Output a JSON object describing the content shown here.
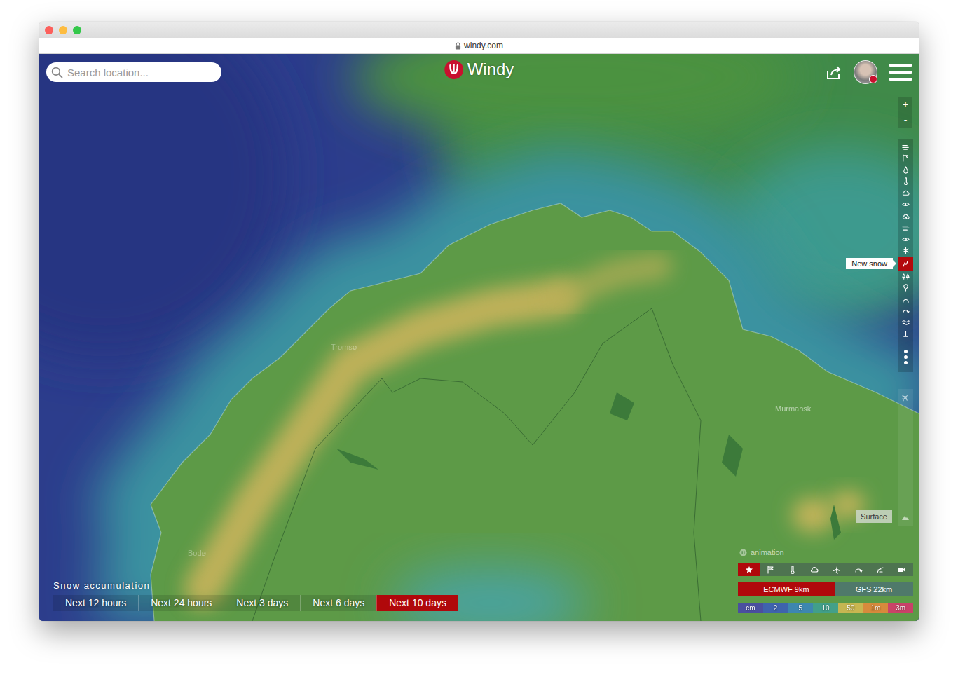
{
  "browser": {
    "url": "windy.com"
  },
  "header": {
    "logo": "Windy",
    "search_placeholder": "Search location..."
  },
  "zoom": {
    "in": "+",
    "out": "-"
  },
  "layers": [
    {
      "selected": false
    },
    {
      "selected": false
    },
    {
      "selected": false
    },
    {
      "selected": false
    },
    {
      "selected": false
    },
    {
      "selected": false
    },
    {
      "selected": false
    },
    {
      "selected": false
    },
    {
      "selected": false
    },
    {
      "selected": false
    },
    {
      "selected": true
    },
    {
      "selected": false
    },
    {
      "selected": false
    },
    {
      "selected": false
    },
    {
      "selected": false
    },
    {
      "selected": false
    },
    {
      "selected": false
    }
  ],
  "layer_tooltip": "New snow",
  "level": {
    "label": "Surface"
  },
  "map_labels": [
    {
      "name": "Tromsø"
    },
    {
      "name": "Murmansk"
    },
    {
      "name": "Bodø"
    }
  ],
  "accumulation": {
    "title": "Snow accumulation",
    "options": [
      {
        "label": "Next 12 hours",
        "selected": false
      },
      {
        "label": "Next 24 hours",
        "selected": false
      },
      {
        "label": "Next 3 days",
        "selected": false
      },
      {
        "label": "Next 6 days",
        "selected": false
      },
      {
        "label": "Next 10 days",
        "selected": true
      }
    ]
  },
  "animation": {
    "label": "animation"
  },
  "quick_layers": [
    {
      "selected": true
    },
    {
      "selected": false
    },
    {
      "selected": false
    },
    {
      "selected": false
    },
    {
      "selected": false
    },
    {
      "selected": false
    },
    {
      "selected": false
    },
    {
      "selected": false
    }
  ],
  "models": [
    {
      "label": "ECMWF 9km",
      "selected": true
    },
    {
      "label": "GFS 22km",
      "selected": false
    }
  ],
  "legend": [
    {
      "label": "cm",
      "color": "#4b4f9f"
    },
    {
      "label": "2",
      "color": "#3f63ad"
    },
    {
      "label": "5",
      "color": "#3d87b0"
    },
    {
      "label": "10",
      "color": "#42a08a"
    },
    {
      "label": "50",
      "color": "#c9b751"
    },
    {
      "label": "1m",
      "color": "#d88a3c"
    },
    {
      "label": "3m",
      "color": "#c9416a"
    }
  ]
}
